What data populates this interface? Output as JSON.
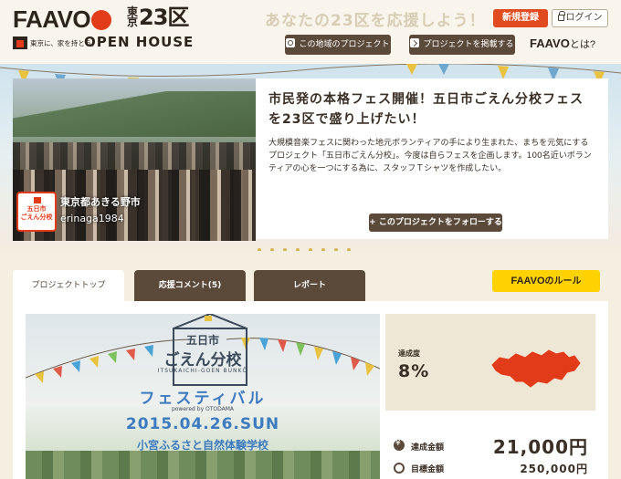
{
  "header": {
    "logo_text": "FAAVO",
    "logo_tokyo": "東京",
    "logo_23ku": "23区",
    "tagline": "東京に、家を持とう。",
    "openhouse": "OPEN HOUSE",
    "slogan": "あなたの23区を応援しよう！",
    "register_label": "新規登録",
    "login_label": "ログイン",
    "area_projects_label": "この地域のプロジェクト",
    "post_project_label": "プロジェクトを掲載する",
    "faavo_what_brand": "FAAVO",
    "faavo_what_suffix": "とは?"
  },
  "hero": {
    "title": "市民発の本格フェス開催！五日市ごえん分校フェスを23区で盛り上げたい！",
    "description": "大規模音楽フェスに関わった地元ボランティアの手により生まれた、まちを元気にするプロジェクト「五日市ごえん分校」。今度は自らフェスを企画します。100名近いボランティアの心を一つにする為に、スタッフＴシャツを作成したい。",
    "follow_label": "+ このプロジェクトをフォローする",
    "location": "東京都あきる野市",
    "owner": "erinaga1984",
    "avatar_text": "五日市\nごえん分校"
  },
  "tabs": {
    "top": "プロジェクトトップ",
    "comments": "応援コメント(5)",
    "report": "レポート",
    "rule_brand": "FAAVO",
    "rule_suffix": "のルール"
  },
  "poster": {
    "line1": "五日市",
    "line2": "ごえん分校",
    "line3": "ITSUKAICHI-GOEN BUNKŌ",
    "fest": "フェスティバル",
    "powered": "powered by OTODAMA",
    "date": "2015.04.26.SUN",
    "venue": "小宮ふるさと自然体験学校"
  },
  "stats": {
    "achievement_label": "達成度",
    "achievement_value": "8%",
    "raised_label": "達成金額",
    "raised_value": "21,000円",
    "target_label": "目標金額",
    "target_value": "250,000円"
  },
  "colors": {
    "accent_red": "#e23b1a",
    "brown": "#5b4a3a",
    "rule_yellow": "#ffd200",
    "beige": "#f5efe2"
  }
}
